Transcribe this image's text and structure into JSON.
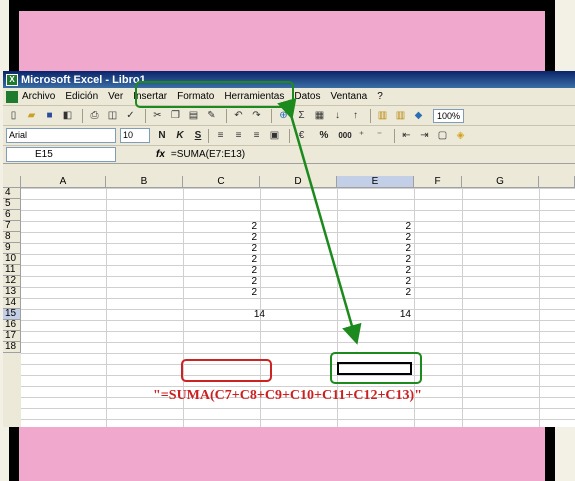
{
  "window": {
    "title": "Microsoft Excel - Libro1"
  },
  "menu": {
    "items": [
      "Archivo",
      "Edición",
      "Ver",
      "Insertar",
      "Formato",
      "Herramientas",
      "Datos",
      "Ventana",
      "?"
    ]
  },
  "toolbar": {
    "zoom": "100%"
  },
  "formatting": {
    "font": "Arial",
    "size": "10",
    "bold": "N",
    "italic": "K",
    "underline": "S",
    "percent": "%",
    "thousands": "000"
  },
  "formula_bar": {
    "cell_ref": "E15",
    "fx_label": "fx",
    "formula": "=SUMA(E7:E13)"
  },
  "sheet": {
    "columns": [
      "A",
      "B",
      "C",
      "D",
      "E",
      "F",
      "G"
    ],
    "rows": [
      "4",
      "5",
      "6",
      "7",
      "8",
      "9",
      "10",
      "11",
      "12",
      "13",
      "14",
      "15",
      "16",
      "17",
      "18"
    ],
    "column_c_values": [
      "2",
      "2",
      "2",
      "2",
      "2",
      "2",
      "2"
    ],
    "column_e_values": [
      "2",
      "2",
      "2",
      "2",
      "2",
      "2",
      "2"
    ],
    "c15": "14",
    "e15": "14",
    "active_column": "E",
    "active_row": "15"
  },
  "annotation": {
    "text": "\"=SUMA(C7+C8+C9+C10+C11+C12+C13)\""
  },
  "colors": {
    "background_pink": "#f0a8cd",
    "frame": "#000000",
    "highlight_green": "#1d8a1d",
    "highlight_red": "#cc2222",
    "annotation_red": "#cc1f1f"
  }
}
